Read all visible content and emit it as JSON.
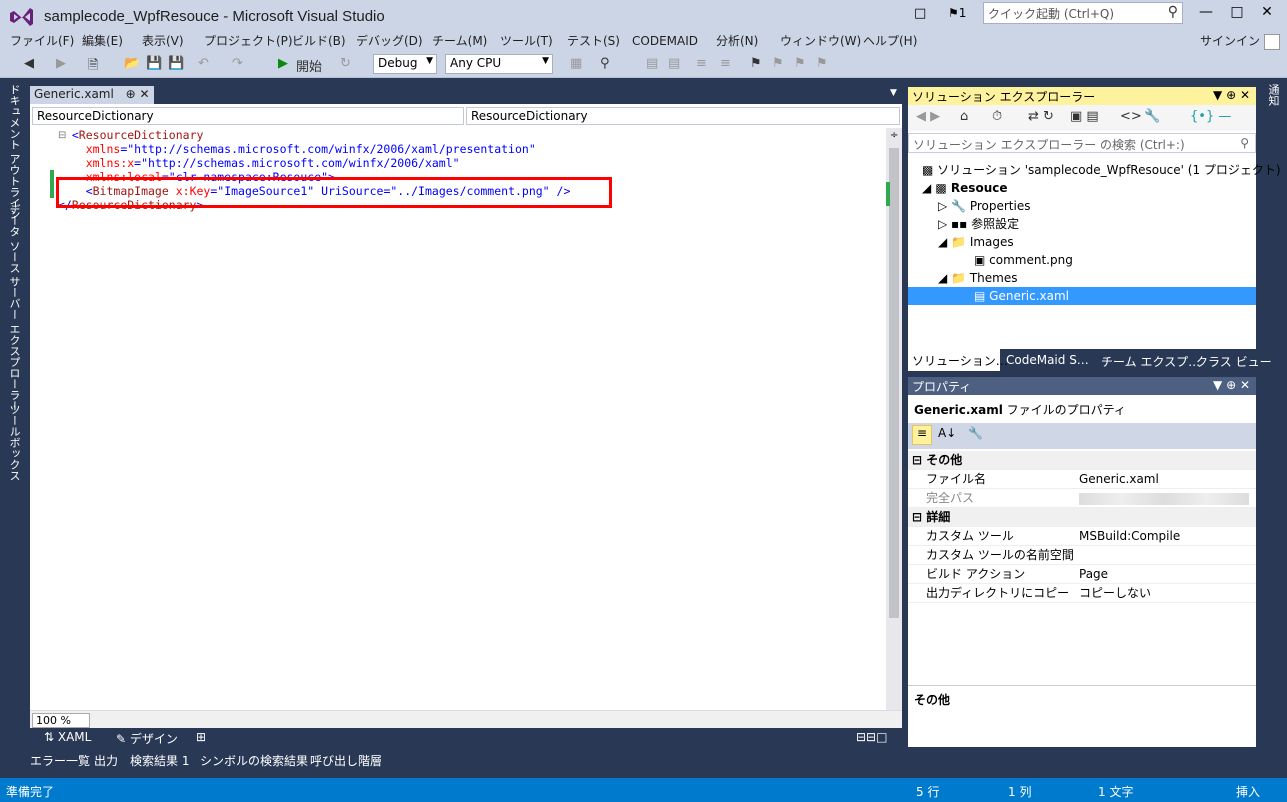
{
  "window": {
    "title": "samplecode_WpfResouce - Microsoft Visual Studio",
    "notification_count": "1",
    "quick_launch_placeholder": "クイック起動 (Ctrl+Q)",
    "signin": "サインイン"
  },
  "menu": [
    "ファイル(F)",
    "編集(E)",
    "表示(V)",
    "プロジェクト(P)",
    "ビルド(B)",
    "デバッグ(D)",
    "チーム(M)",
    "ツール(T)",
    "テスト(S)",
    "CODEMAID",
    "分析(N)",
    "ウィンドウ(W)",
    "ヘルプ(H)"
  ],
  "toolbar": {
    "start_label": "開始",
    "config": "Debug",
    "platform": "Any CPU"
  },
  "left_tabs": [
    "ドキュメント アウトライン",
    "データ ソース",
    "サーバー エクスプローラー",
    "ツールボックス"
  ],
  "right_tabs": [
    "通知"
  ],
  "editor": {
    "tab_label": "Generic.xaml",
    "nav_left": "ResourceDictionary",
    "nav_right": "ResourceDictionary",
    "zoom": "100 %",
    "view_xaml": "XAML",
    "view_design": "デザイン",
    "lines": [
      {
        "t1": "<",
        "t2": "ResourceDictionary",
        "t3": "",
        "t4": "",
        "t5": ""
      },
      {
        "t1": "    ",
        "t2": "",
        "t3": "xmlns",
        "t4": "=\"http://schemas.microsoft.com/winfx/2006/xaml/presentation\"",
        "t5": ""
      },
      {
        "t1": "    ",
        "t2": "",
        "t3": "xmlns:x",
        "t4": "=\"http://schemas.microsoft.com/winfx/2006/xaml\"",
        "t5": ""
      },
      {
        "t1": "    ",
        "t2": "",
        "t3": "xmlns:local",
        "t4": "=\"clr-namespace:Resouce\"",
        "t5": ">"
      },
      {
        "t1": "    <",
        "t2": "BitmapImage",
        "t3": " x:Key",
        "t4": "=\"ImageSource1\"",
        "t5": " UriSource=\"../Images/comment.png\" />"
      },
      {
        "t1": "</",
        "t2": "ResourceDictionary",
        "t3": "",
        "t4": "",
        "t5": ">"
      }
    ]
  },
  "solution_explorer": {
    "title": "ソリューション エクスプローラー",
    "search_placeholder": "ソリューション エクスプローラー の検索 (Ctrl+:)",
    "items": [
      {
        "label": "ソリューション 'samplecode_WpfResouce' (1 プロジェクト)"
      },
      {
        "label": "Resouce"
      },
      {
        "label": "Properties"
      },
      {
        "label": "参照設定"
      },
      {
        "label": "Images"
      },
      {
        "label": "comment.png"
      },
      {
        "label": "Themes"
      },
      {
        "label": "Generic.xaml"
      }
    ],
    "tabs": [
      "ソリューション…",
      "CodeMaid S…",
      "チーム エクスプ…",
      "クラス ビュー"
    ]
  },
  "properties": {
    "title": "プロパティ",
    "object": "Generic.xaml",
    "object_type": "ファイルのプロパティ",
    "cat1": "その他",
    "cat2": "詳細",
    "rows": [
      {
        "k": "ファイル名",
        "v": "Generic.xaml"
      },
      {
        "k": "完全パス",
        "v": ""
      },
      {
        "k": "カスタム ツール",
        "v": "MSBuild:Compile"
      },
      {
        "k": "カスタム ツールの名前空間",
        "v": ""
      },
      {
        "k": "ビルド アクション",
        "v": "Page"
      },
      {
        "k": "出力ディレクトリにコピー",
        "v": "コピーしない"
      }
    ],
    "desc_title": "その他"
  },
  "bottom_tabs": [
    "エラー一覧",
    "出力",
    "検索結果 1",
    "シンボルの検索結果",
    "呼び出し階層"
  ],
  "status": {
    "ready": "準備完了",
    "line": "5 行",
    "col": "1 列",
    "ch": "1 文字",
    "mode": "挿入"
  }
}
